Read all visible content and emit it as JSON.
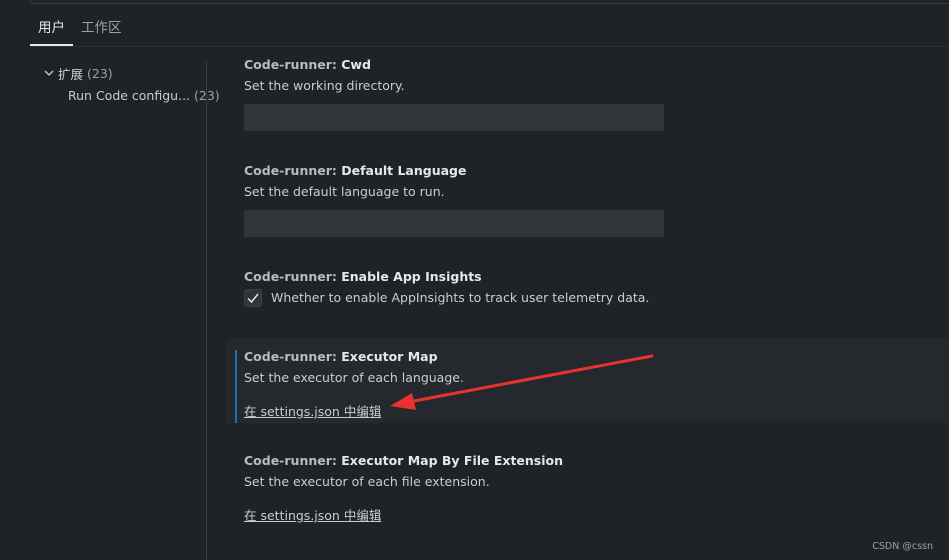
{
  "tabs": [
    {
      "label": "用户",
      "active": true
    },
    {
      "label": "工作区",
      "active": false
    }
  ],
  "toc": {
    "group_label": "扩展",
    "group_count": "(23)",
    "child_label": "Run Code configu...",
    "child_count": "(23)"
  },
  "settings": [
    {
      "category": "Code-runner: ",
      "name": "Cwd",
      "description": "Set the working directory."
    },
    {
      "category": "Code-runner: ",
      "name": "Default Language",
      "description": "Set the default language to run."
    },
    {
      "category": "Code-runner: ",
      "name": "Enable App Insights",
      "description": "Whether to enable AppInsights to track user telemetry data.",
      "checked": true
    },
    {
      "category": "Code-runner: ",
      "name": "Executor Map",
      "description": "Set the executor of each language.",
      "link": "在 settings.json 中编辑"
    },
    {
      "category": "Code-runner: ",
      "name": "Executor Map By File Extension",
      "description": "Set the executor of each file extension.",
      "link": "在 settings.json 中编辑"
    }
  ],
  "watermark": "CSDN @cssn",
  "colors": {
    "accent": "#0e7ab5",
    "arrow": "#e8322f"
  }
}
